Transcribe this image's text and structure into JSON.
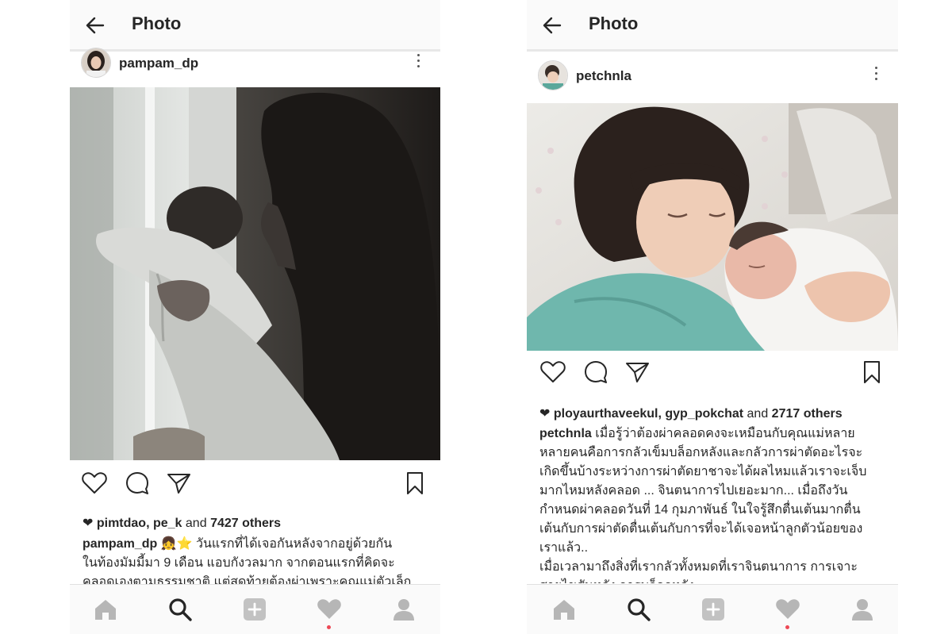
{
  "screens": [
    {
      "header": {
        "title": "Photo",
        "back_icon": "arrow-left-icon"
      },
      "post": {
        "username": "pampam_dp",
        "liked_by": [
          "pimtdao",
          "pe_k"
        ],
        "and_text": "and",
        "others": "7427 others",
        "caption_user": "pampam_dp",
        "caption_emoji": "👧⭐",
        "caption_lines": [
          "วันแรกที่ได้เจอกันหลังจากอยู่ด้วยกัน",
          "ในท้องมัมมี้มา 9 เดือน แอบกังวลมาก จากตอนแรกที่คิดจะ",
          "คลอดเองตามธรรมชาติ แต่สุดท้ายต้องผ่าเพราะคุณแม่ตัวเล็ก"
        ]
      }
    },
    {
      "header": {
        "title": "Photo",
        "back_icon": "arrow-left-icon"
      },
      "post": {
        "username": "petchnla",
        "liked_by": [
          "ployaurthaveekul",
          "gyp_pokchat"
        ],
        "and_text": "and",
        "others": "2717 others",
        "caption_user": "petchnla",
        "caption_lines": [
          "เมื่อรู้ว่าต้องผ่าคลอดคงจะเหมือนกับคุณแม่หลาย",
          "หลายคนคือการกลัวเข็มบล็อกหลังและกลัวการผ่าตัดอะไรจะ",
          "เกิดขึ้นบ้างระหว่างการผ่าตัดยาชาจะได้ผลไหมแล้วเราจะเจ็บ",
          "มากไหมหลังคลอด ... จินตนาการไปเยอะมาก... เมื่อถึงวัน",
          "กำหนดผ่าคลอดวันที่ 14 กุมภาพันธ์ ในใจรู้สึกตื่นเต้นมากตื่น",
          "เต้นกับการผ่าตัดตื่นเต้นกับการที่จะได้เจอหน้าลูกตัวน้อยของ",
          "เราแล้ว..",
          "เมื่อเวลามาถึงสิ่งที่เรากลัวทั้งหมดที่เราจินตนาการ การเจาะ",
          "สายไขสันหลัง การบล็อกหลัง"
        ]
      }
    }
  ],
  "action_icons": [
    "heart-icon",
    "comment-icon",
    "share-icon",
    "bookmark-icon"
  ],
  "tab_icons": [
    "home-icon",
    "search-icon",
    "add-icon",
    "activity-heart-icon",
    "profile-icon"
  ],
  "colors": {
    "notification_dot": "#ed4956",
    "bar_background": "#fafafa",
    "text": "#262626"
  }
}
